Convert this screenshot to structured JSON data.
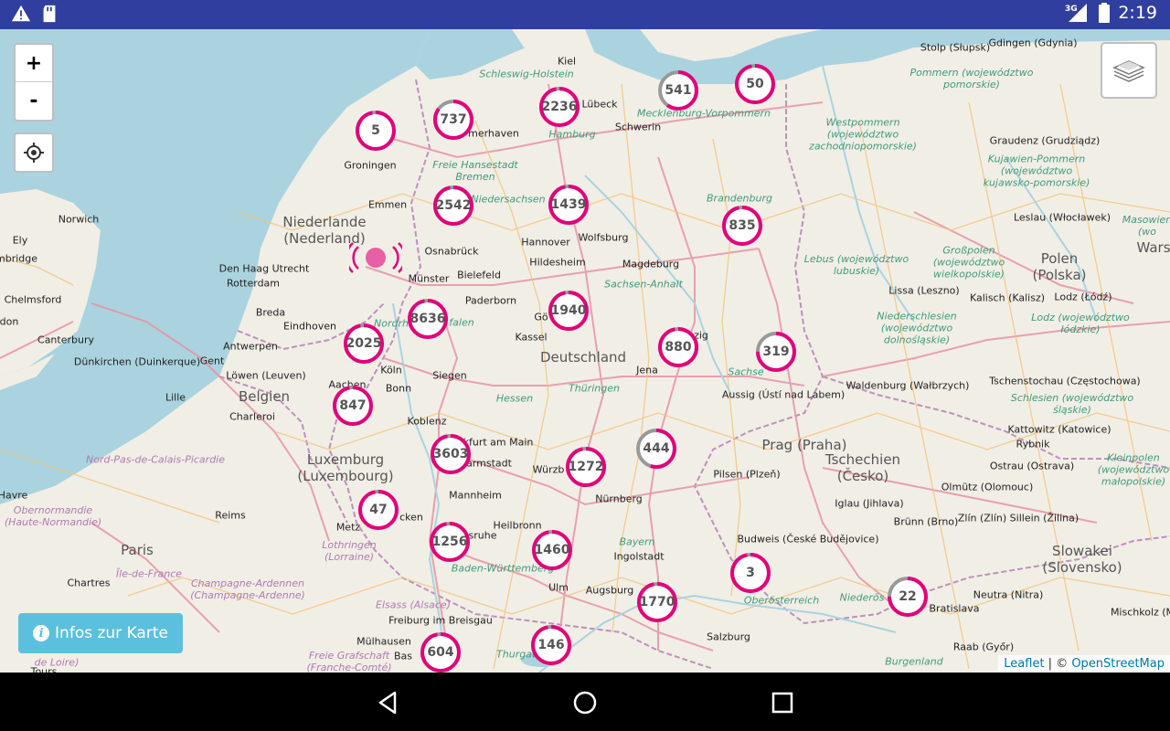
{
  "status_bar": {
    "left_icons": [
      "warning-icon",
      "sd-card-icon"
    ],
    "network": "3G",
    "time": "2:19"
  },
  "map": {
    "zoom_in_label": "+",
    "zoom_out_label": "-",
    "info_button_label": "Infos zur Karte",
    "attribution": {
      "leaflet": "Leaflet",
      "separator": " | © ",
      "osm": "OpenStreetMap"
    },
    "clusters": [
      {
        "label": "5",
        "fill": 0.97
      },
      {
        "label": "737",
        "fill": 0.85
      },
      {
        "label": "2236",
        "fill": 0.97
      },
      {
        "label": "541",
        "fill": 0.6
      },
      {
        "label": "50",
        "fill": 0.97
      },
      {
        "label": "2542",
        "fill": 0.97
      },
      {
        "label": "1439",
        "fill": 0.97
      },
      {
        "label": "835",
        "fill": 0.97
      },
      {
        "label": "8636",
        "fill": 0.97
      },
      {
        "label": "1940",
        "fill": 0.97
      },
      {
        "label": "2025",
        "fill": 0.97
      },
      {
        "label": "880",
        "fill": 0.97
      },
      {
        "label": "319",
        "fill": 0.75
      },
      {
        "label": "847",
        "fill": 0.97
      },
      {
        "label": "3603",
        "fill": 0.97
      },
      {
        "label": "1272",
        "fill": 0.97
      },
      {
        "label": "444",
        "fill": 0.55
      },
      {
        "label": "47",
        "fill": 0.97
      },
      {
        "label": "1256",
        "fill": 0.97
      },
      {
        "label": "1460",
        "fill": 0.97
      },
      {
        "label": "3",
        "fill": 0.97
      },
      {
        "label": "1770",
        "fill": 0.97
      },
      {
        "label": "22",
        "fill": 0.75
      },
      {
        "label": "604",
        "fill": 0.97
      },
      {
        "label": "146",
        "fill": 0.97
      }
    ],
    "places": {
      "kiel": "Kiel",
      "luebeck": "Lübeck",
      "schwerin": "Schwerin",
      "hamburg": "Hamburg",
      "bremerhaven": "merhaven",
      "groningen": "Groningen",
      "emmen": "Emmen",
      "osnabrueck": "Osnabrück",
      "hannover": "Hannover",
      "wolfsburg": "Wolfsburg",
      "magdeburg": "Magdeburg",
      "hildesheim": "Hildesheim",
      "bielefeld": "Bielefeld",
      "muenster": "Münster",
      "paderborn": "Paderborn",
      "goettingen": "Gö",
      "kassel": "Kassel",
      "jena": "Jena",
      "koeln": "Köln",
      "bonn": "Bonn",
      "siegen": "Siegen",
      "aachen": "Aachen",
      "koblenz": "Koblenz",
      "frankfurt": "kfurt am Main",
      "darmstadt": "armstadt",
      "wuerzburg": "Würzb",
      "nuernberg": "Nürnberg",
      "mannheim": "Mannheim",
      "heilbronn": "Heilbronn",
      "karlsruhe": "sruhe",
      "ingolstadt": "Ingolstadt",
      "ulm": "Ulm",
      "augsburg": "Augsburg",
      "freiburg": "Freiburg im Breisgau",
      "muelhausen": "Mülhausen",
      "basel": "Bas",
      "salzburg": "Salzburg",
      "metz": "Metz",
      "saarbruecken": "cken",
      "luexembourg_city": "Luxembourg",
      "leipzig": "zig",
      "stolp": "Stolp (Słupsk)",
      "gdingen": "Gdingen (Gdynia)",
      "graudenz": "Graudenz (Grudziądz)",
      "leslau": "Leslau (Włocławek)",
      "lissa": "Lissa (Leszno)",
      "kalisch": "Kalisch (Kalisz)",
      "lodz": "Lodz (Łódź)",
      "waldenburg": "Waldenburg (Wałbrzych)",
      "tschenstochau": "Tschenstochau (Częstochowa)",
      "aussig": "Aussig (Ústí nad Labem)",
      "kattowitz": "Kattowitz (Katowice)",
      "rybnik": "Rybnik",
      "ostrau": "Ostrau (Ostrava)",
      "olmuetz": "Olmütz (Olomouc)",
      "pilsen": "Pilsen (Plzeň)",
      "iglau": "Iglau (Jihlava)",
      "bruenn": "Brünn (Brno)",
      "zlin": "Zlín (Zlín) Sillein (Žilina)",
      "budweis": "Budweis (České Budějovice)",
      "neutra": "Neutra (Nitra)",
      "raab": "Raab (Győr)",
      "mischkolz": "Mischkolz (M",
      "bratislava": "Bratislava",
      "norwich": "Norwich",
      "ely": "Ely",
      "cambridge": "mbridge",
      "chelmsford": "Chelmsford",
      "london": "don",
      "canterbury": "Canterbury",
      "denhaag": "Den Haag Utrecht",
      "rotterdam": "Rotterdam",
      "breda": "Breda",
      "eindhoven": "Eindhoven",
      "antwerpen": "Antwerpen",
      "duenkirchen": "Dünkirchen (Duinkerque)",
      "gent": "Gent",
      "loewen": "Löwen (Leuven)",
      "lille": "Lille",
      "charleroi": "Charleroi",
      "reims": "Reims",
      "paris": "Paris",
      "chartres": "Chartres",
      "havre": "Havre",
      "tours": "Tours",
      "warsaw": "Wars"
    },
    "countries": {
      "germany": "Deutschland",
      "netherlands": "Niederlande\n(Nederland)",
      "belgium": "Belgien",
      "luxembourg": "Luxemburg\n(Luxembourg)",
      "czech": "Tschechien\n(Česko)",
      "prague": "Prag (Praha)",
      "poland": "Polen\n(Polska)",
      "slovakia": "Slowakei\n(Slovensko)"
    },
    "regions": {
      "sh": "Schleswig-Holstein",
      "mv": "Mecklenburg-Vorpommern",
      "hb": "Freie Hansestadt\nBremen",
      "ns": "Niedersachsen",
      "bb": "Brandenburg",
      "st": "Sachsen-Anhalt",
      "nrw": "Nordrh",
      "westfalen": "falen",
      "th": "Thüringen",
      "sn": "Sachse",
      "he": "Hessen",
      "by": "Bayern",
      "bw": "Baden-Württemberg",
      "ooe": "Oberösterreich",
      "noe": "Niederös",
      "bgl": "Burgenland",
      "pomm": "Pommern (województwo\npomorskie)",
      "westpomm": "Westpommern\n(województwo\nzachodniopomorskie)",
      "kuj": "Kujawien-Pommern\n(województwo\nkujawsko-pomorskie)",
      "lebus": "Lebus (województwo\nlubuskie)",
      "grosspolen": "Großpolen\n(województwo\nwielkopolskie)",
      "niederschl": "Niederschlesien\n(województwo\ndolnośląskie)",
      "lodzregion": "Lodz (województwo\nłódzkie)",
      "schlesien": "Schlesien (województwo\nśląskie)",
      "kleinpolen": "Kleinpolen\n(województwo\nmałopolskie)",
      "masowien": "Masowien\n(wo",
      "nordpas": "Nord-Pas-de-Calais-Picardie",
      "champagne": "Champagne-Ardennen\n(Champagne-Ardenne)",
      "lothringen": "Lothringen\n(Lorraine)",
      "iledefrance": "Île-de-France",
      "elsass": "Elsass (Alsace)",
      "freigraf": "Freie Grafschaft\n(Franche-Comté)",
      "obernormandie": "Obernormandie\n(Haute-Normandie)",
      "thurgau": "Thurgau",
      "loire": "de Loire)"
    }
  }
}
